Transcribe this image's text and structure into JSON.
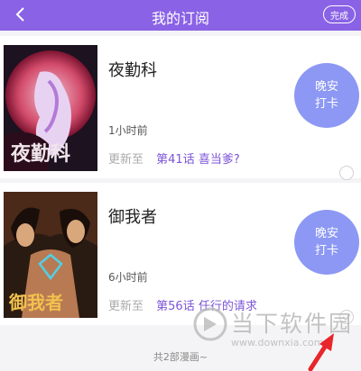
{
  "header": {
    "title": "我的订阅",
    "done_label": "完成",
    "background": "#8a62e6"
  },
  "subscriptions": [
    {
      "cover_text": "夜勤科",
      "title": "夜勤科",
      "time": "1小时前",
      "update_label": "更新至",
      "episode": "第41话 喜当爹?",
      "checkin_line1": "晚安",
      "checkin_line2": "打卡"
    },
    {
      "cover_text": "御我者",
      "title": "御我者",
      "time": "6小时前",
      "update_label": "更新至",
      "episode": "第56话 任行的请求",
      "checkin_line1": "晚安",
      "checkin_line2": "打卡"
    }
  ],
  "footer": {
    "text": "共2部漫画~"
  },
  "watermark": {
    "main": "当下软件园",
    "url": "www.downxia.com"
  },
  "colors": {
    "accent": "#7d55d8",
    "checkin": "#8c98f3",
    "annotation_arrow": "#e8262b"
  }
}
